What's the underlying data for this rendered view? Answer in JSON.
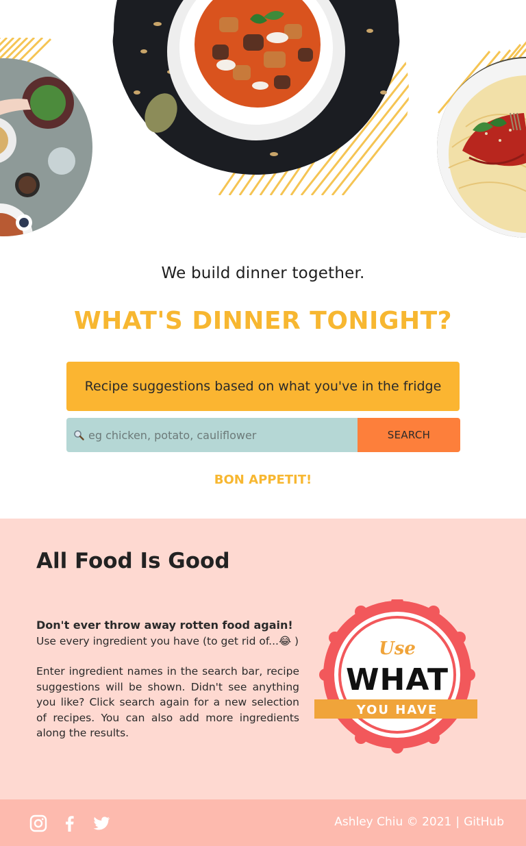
{
  "hero": {
    "tagline": "We build dinner together.",
    "headline": "WHAT'S DINNER TONIGHT?",
    "banner": "Recipe suggestions based on what you've in the fridge",
    "search": {
      "placeholder": "eg chicken, potato, cauliflower",
      "value": "",
      "button_label": "SEARCH"
    },
    "signoff": "BON APPETIT!"
  },
  "about": {
    "title": "All Food Is Good",
    "bold_line": "Don't ever throw away rotten food again!",
    "line2": "Use every ingredient you have (to get rid of...😂 )",
    "paragraph": "Enter ingredient names in the search bar, recipe suggestions will be shown. Didn't see anything you like? Click search again for a new selection of recipes. You can also add more ingredients along the results.",
    "badge": {
      "top": "Use",
      "middle": "WHAT",
      "ribbon": "YOU HAVE"
    }
  },
  "footer": {
    "credit": "Ashley Chiu © 2021",
    "separator": "|",
    "link": "GitHub",
    "icons": [
      "instagram-icon",
      "facebook-icon",
      "twitter-icon"
    ]
  },
  "colors": {
    "accent_yellow": "#f7b731",
    "banner_yellow": "#fbb531",
    "search_teal": "#b5d7d5",
    "search_orange": "#fd7f3b",
    "about_bg": "#fed9d1",
    "footer_bg": "#fdbaae",
    "badge_red": "#f2585b"
  }
}
